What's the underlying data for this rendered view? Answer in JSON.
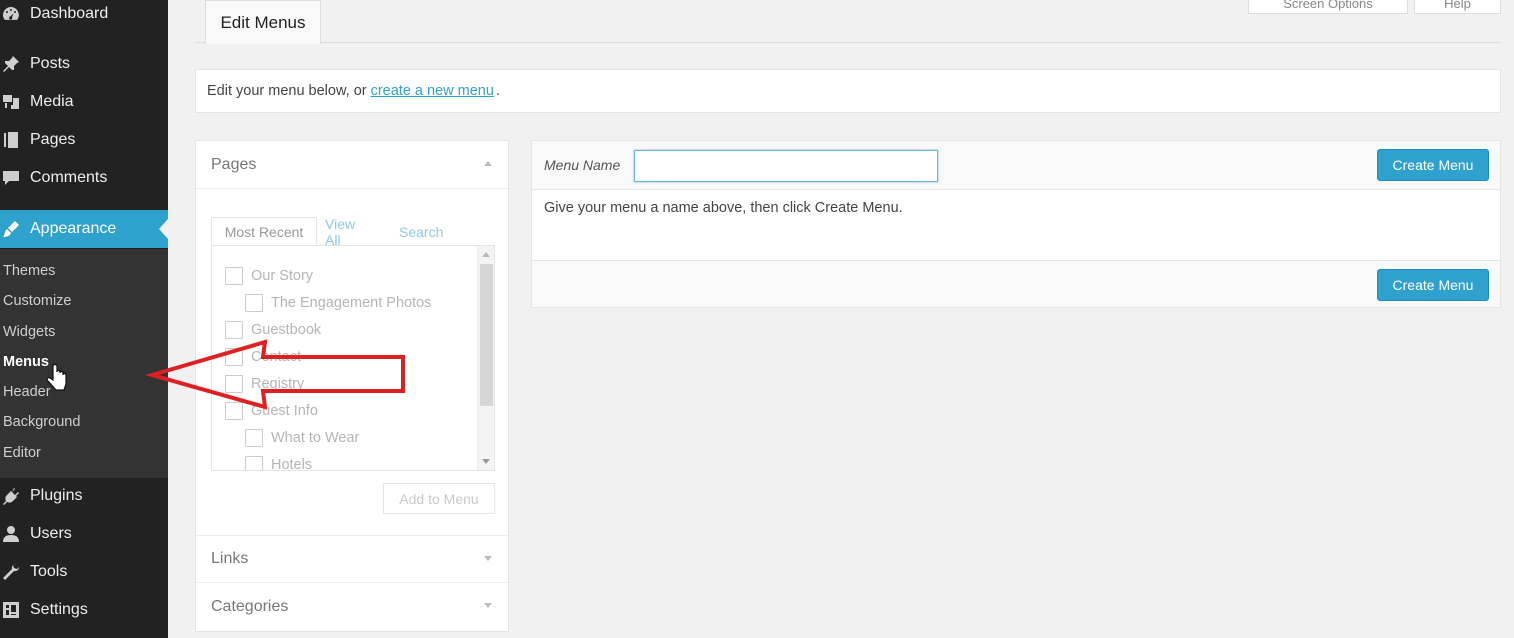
{
  "sidebar": {
    "items": [
      {
        "label": "Dashboard",
        "icon": "dashboard-icon"
      },
      {
        "label": "Posts",
        "icon": "pin-icon"
      },
      {
        "label": "Media",
        "icon": "media-icon"
      },
      {
        "label": "Pages",
        "icon": "pages-icon"
      },
      {
        "label": "Comments",
        "icon": "comment-icon"
      },
      {
        "label": "Appearance",
        "icon": "brush-icon"
      },
      {
        "label": "Plugins",
        "icon": "plug-icon"
      },
      {
        "label": "Users",
        "icon": "user-icon"
      },
      {
        "label": "Tools",
        "icon": "wrench-icon"
      },
      {
        "label": "Settings",
        "icon": "settings-icon"
      }
    ],
    "submenu": [
      "Themes",
      "Customize",
      "Widgets",
      "Menus",
      "Header",
      "Background",
      "Editor"
    ]
  },
  "header": {
    "tab_label": "Edit Menus",
    "screen_options": "Screen Options",
    "help": "Help"
  },
  "notice": {
    "prefix": "Edit your menu below, or",
    "link": "create a new menu",
    "suffix": "."
  },
  "left_panel": {
    "pages_title": "Pages",
    "tabs": [
      "Most Recent",
      "View All",
      "Search"
    ],
    "pages": [
      {
        "label": "Our Story",
        "indent": 0
      },
      {
        "label": "The Engagement Photos",
        "indent": 1
      },
      {
        "label": "Guestbook",
        "indent": 0
      },
      {
        "label": "Contact",
        "indent": 0
      },
      {
        "label": "Registry",
        "indent": 0
      },
      {
        "label": "Guest Info",
        "indent": 0
      },
      {
        "label": "What to Wear",
        "indent": 1
      },
      {
        "label": "Hotels",
        "indent": 1
      }
    ],
    "add_button": "Add to Menu",
    "links_title": "Links",
    "categories_title": "Categories"
  },
  "menu_panel": {
    "name_label": "Menu Name",
    "name_value": "",
    "create_button": "Create Menu",
    "instructions": "Give your menu a name above, then click Create Menu."
  },
  "colors": {
    "accent": "#2ea2cc",
    "sidebar_bg": "#222222",
    "submenu_bg": "#333333",
    "annotation_arrow": "#e02020"
  }
}
